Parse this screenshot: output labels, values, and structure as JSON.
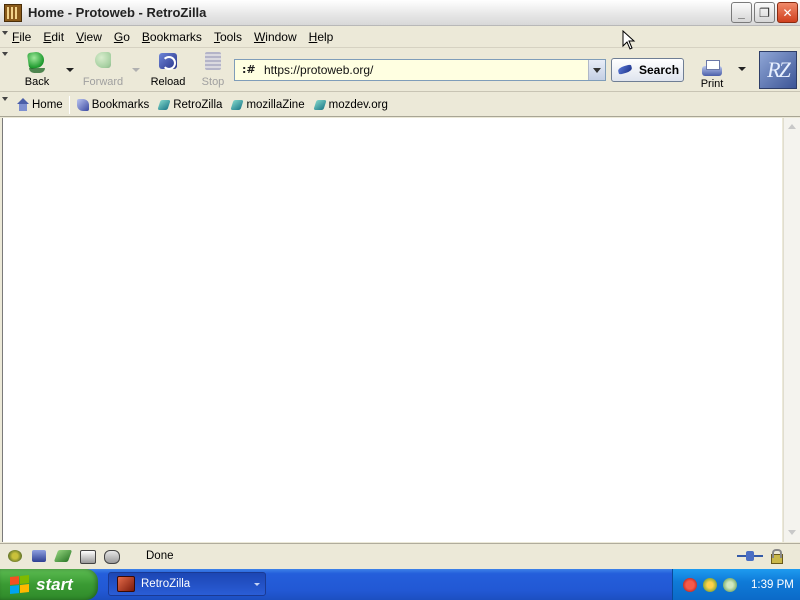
{
  "window": {
    "title": "Home - Protoweb - RetroZilla",
    "buttons": {
      "minimize": "_",
      "restore": "❐",
      "close": "✕"
    }
  },
  "menubar": {
    "items": [
      {
        "label": "File",
        "accel": "F"
      },
      {
        "label": "Edit",
        "accel": "E"
      },
      {
        "label": "View",
        "accel": "V"
      },
      {
        "label": "Go",
        "accel": "G"
      },
      {
        "label": "Bookmarks",
        "accel": "B"
      },
      {
        "label": "Tools",
        "accel": "T"
      },
      {
        "label": "Window",
        "accel": "W"
      },
      {
        "label": "Help",
        "accel": "H"
      }
    ]
  },
  "navbar": {
    "back": "Back",
    "forward": "Forward",
    "reload": "Reload",
    "stop": "Stop",
    "url": "https://protoweb.org/",
    "search": "Search",
    "print": "Print",
    "throbber": "RZ"
  },
  "personalbar": {
    "items": [
      "Home",
      "Bookmarks",
      "RetroZilla",
      "mozillaZine",
      "mozdev.org"
    ]
  },
  "statusbar": {
    "text": "Done"
  },
  "taskbar": {
    "start": "start",
    "task": "RetroZilla",
    "clock": "1:39 PM"
  },
  "colors": {
    "chrome": "#ece9d8",
    "content": "#ffffff",
    "taskbar": "#245edb",
    "start": "#3a9a33",
    "url_bg": "#ffffe1"
  },
  "icons": {
    "app": "retrozilla-icon",
    "back": "back-arrow-icon",
    "forward": "forward-arrow-icon",
    "reload": "reload-icon",
    "stop": "stop-icon",
    "search": "search-icon",
    "print": "printer-icon",
    "home": "home-icon",
    "bookmarks": "bookmarks-icon",
    "bookmark_page": "bookmark-page-icon"
  }
}
